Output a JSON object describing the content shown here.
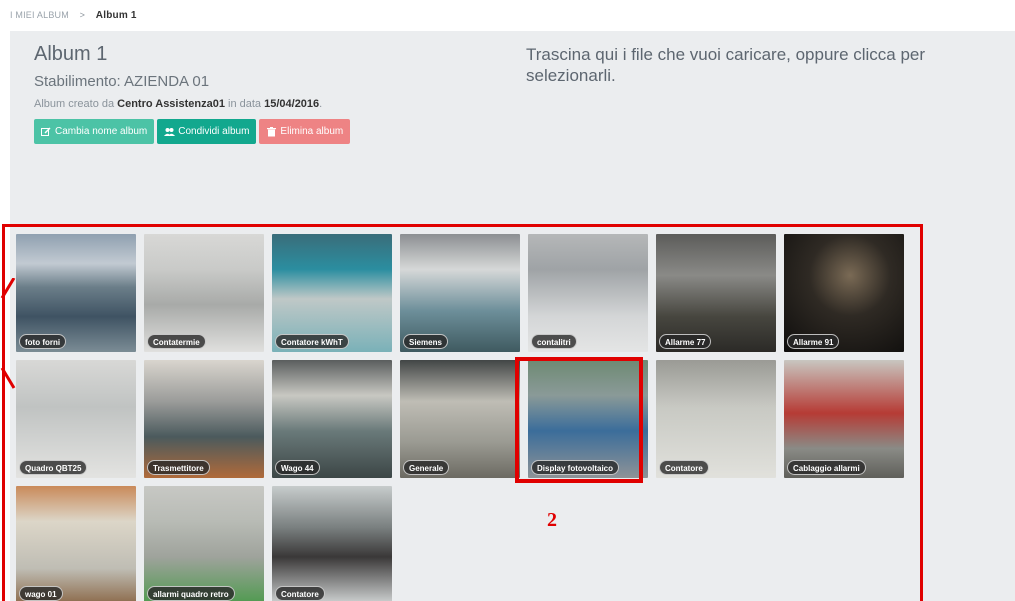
{
  "breadcrumb": {
    "root": "I MIEI ALBUM",
    "separator": ">",
    "current": "Album 1"
  },
  "album": {
    "title": "Album 1",
    "site": "Stabilimento: AZIENDA 01",
    "created_prefix": "Album creato da ",
    "created_by": "Centro Assistenza01",
    "created_mid": " in data ",
    "created_date": "15/04/2016",
    "created_suffix": "."
  },
  "actions": {
    "rename": "Cambia nome album",
    "share": "Condividi album",
    "delete": "Elimina album"
  },
  "dropzone": {
    "text": "Trascina qui i file che vuoi caricare, oppure clicca per selezionarli."
  },
  "photos": [
    {
      "label": "foto forni"
    },
    {
      "label": "Contatermie"
    },
    {
      "label": "Contatore kWhT"
    },
    {
      "label": "Siemens"
    },
    {
      "label": "contalitri"
    },
    {
      "label": "Allarme 77"
    },
    {
      "label": "Allarme 91"
    },
    {
      "label": "Quadro QBT25"
    },
    {
      "label": "Trasmettitore"
    },
    {
      "label": "Wago 44"
    },
    {
      "label": "Generale"
    },
    {
      "label": "Display fotovoltaico"
    },
    {
      "label": "Contatore"
    },
    {
      "label": "Cablaggio allarmi"
    },
    {
      "label": "wago 01"
    },
    {
      "label": "allarmi quadro retro"
    },
    {
      "label": "Contatore"
    }
  ],
  "annotation": {
    "number": "2",
    "color": "#e00000"
  },
  "colors": {
    "teal": "#4cc3a6",
    "green": "#12a88e",
    "red": "#ee8384"
  }
}
